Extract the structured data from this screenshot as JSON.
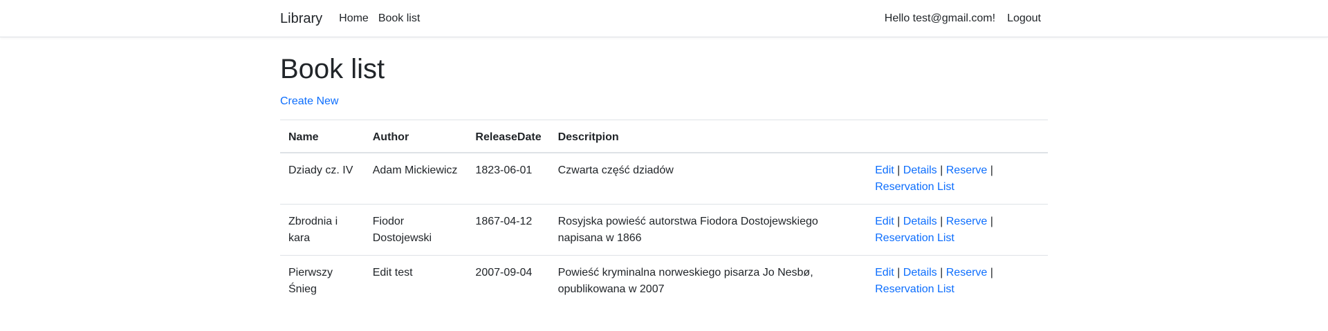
{
  "navbar": {
    "brand": "Library",
    "links": [
      "Home",
      "Book list"
    ],
    "greeting": "Hello test@gmail.com!",
    "logout": "Logout"
  },
  "page": {
    "title": "Book list",
    "create_new": "Create New"
  },
  "table": {
    "headers": [
      "Name",
      "Author",
      "ReleaseDate",
      "Descritpion",
      ""
    ],
    "actions": {
      "edit": "Edit",
      "details": "Details",
      "reserve": "Reserve",
      "reservation_list": "Reservation List",
      "separator": "|"
    },
    "rows": [
      {
        "name": "Dziady cz. IV",
        "author": "Adam Mickiewicz",
        "release_date": "1823-06-01",
        "description": "Czwarta część dziadów"
      },
      {
        "name": "Zbrodnia i kara",
        "author": "Fiodor Dostojewski",
        "release_date": "1867-04-12",
        "description": "Rosyjska powieść autorstwa Fiodora Dostojewskiego napisana w 1866"
      },
      {
        "name": "Pierwszy Śnieg",
        "author": "Edit test",
        "release_date": "2007-09-04",
        "description": "Powieść kryminalna norweskiego pisarza Jo Nesbø, opublikowana w 2007"
      }
    ]
  }
}
